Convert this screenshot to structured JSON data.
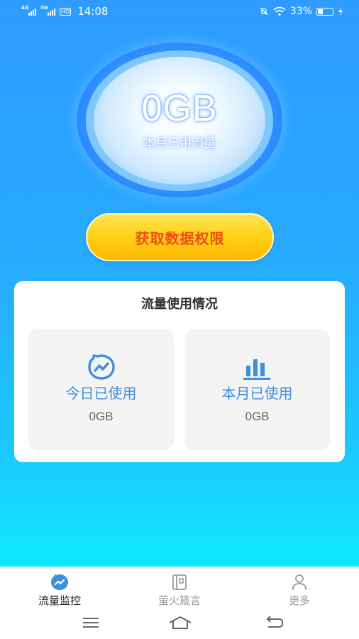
{
  "status_bar": {
    "net1": "4G",
    "net2": "5G",
    "hd": "HD",
    "time": "14:08",
    "battery": "33%"
  },
  "usage": {
    "value": "0GB",
    "label": "本月已用流量"
  },
  "permission_button": {
    "label": "获取数据权限"
  },
  "stats_card": {
    "title": "流量使用情况",
    "today": {
      "label": "今日已使用",
      "value": "0GB",
      "icon": "chart-bubble-icon"
    },
    "month": {
      "label": "本月已使用",
      "value": "0GB",
      "icon": "bar-chart-icon"
    }
  },
  "bottom_nav": {
    "items": [
      {
        "label": "流量监控",
        "icon": "traffic-monitor-icon",
        "active": true
      },
      {
        "label": "萤火箴言",
        "icon": "notebook-icon",
        "active": false
      },
      {
        "label": "更多",
        "icon": "user-icon",
        "active": false
      }
    ]
  },
  "colors": {
    "accent": "#3f8fe0",
    "button_text": "#f04b19",
    "button_fill": "#ffd21a",
    "bg_top": "#2f9bff",
    "bg_bottom": "#0ee8ff"
  }
}
